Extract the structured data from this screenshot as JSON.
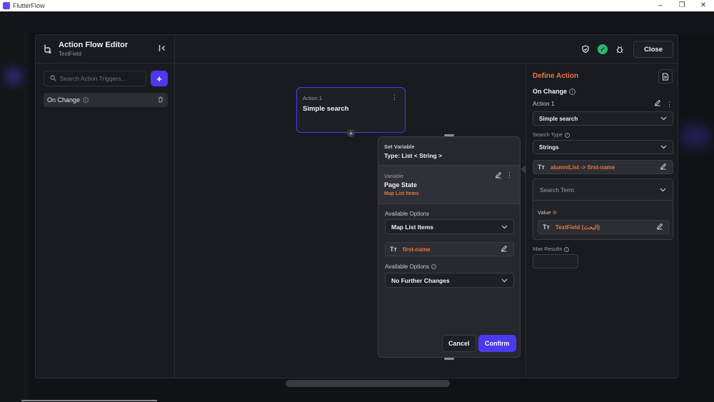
{
  "window": {
    "title": "FlutterFlow",
    "minimize": "–",
    "restore": "❐",
    "close": "✕"
  },
  "editor": {
    "title": "Action Flow Editor",
    "subtitle": "TextField",
    "close_label": "Close"
  },
  "left_panel": {
    "search_placeholder": "Search Action Triggers...",
    "add_label": "+",
    "triggers": [
      {
        "label": "On Change"
      }
    ]
  },
  "canvas": {
    "node": {
      "label": "Action 1",
      "title": "Simple search"
    },
    "popup": {
      "type_label": "Set Variable",
      "type_value": "Type: List < String >",
      "variable_label": "Variable",
      "variable_value": "Page State",
      "variable_sub": "Map List Items",
      "options1_label": "Available Options",
      "options1_value": "Map List Items",
      "chip_value": "first-name",
      "options2_label": "Available Options",
      "options2_value": "No Further Changes",
      "cancel_label": "Cancel",
      "confirm_label": "Confirm"
    }
  },
  "right_panel": {
    "title": "Define Action",
    "trigger": "On Change",
    "action_label": "Action 1",
    "action_value": "Simple search",
    "search_type_label": "Search Type",
    "search_type_value": "Strings",
    "list_chip": "alumniList -> first-name",
    "search_term_label": "Search Term",
    "value_label": "Value",
    "value_chip": "TextField (البحث)",
    "max_results_label": "Max Results"
  },
  "colors": {
    "accent": "#4b39ef",
    "highlight": "#e8763c",
    "success": "#2bb673"
  }
}
